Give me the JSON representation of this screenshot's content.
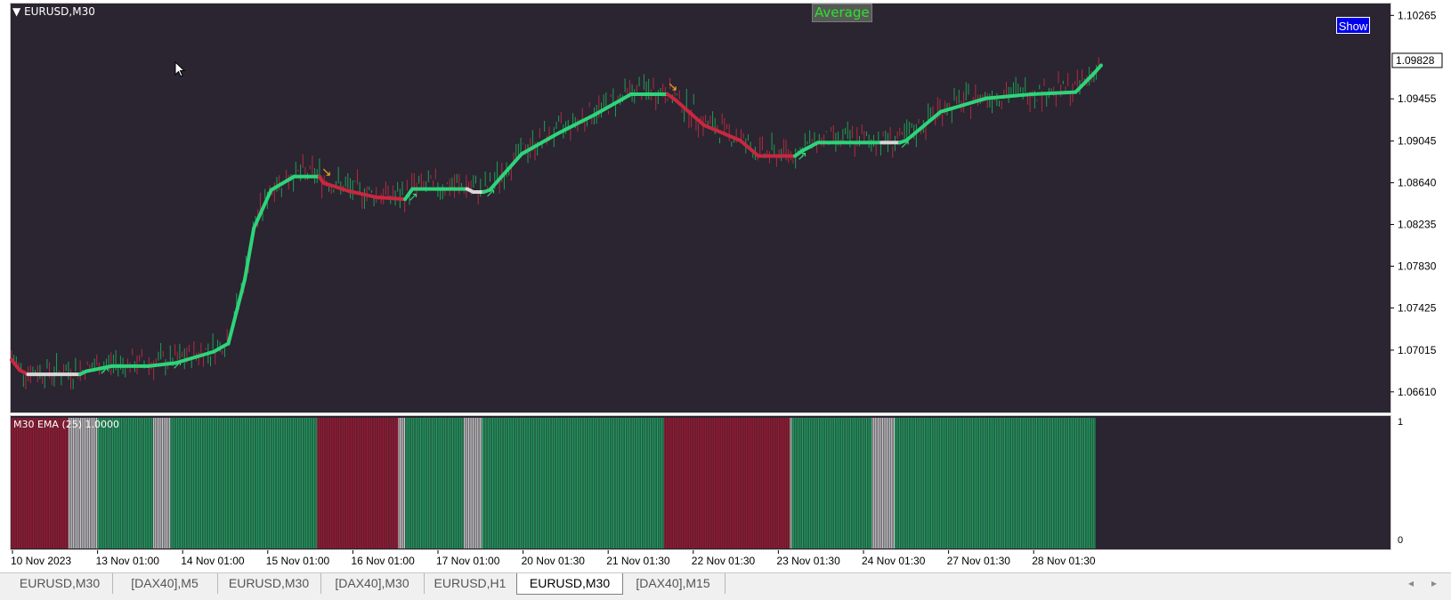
{
  "chart": {
    "symbol_label": "EURUSD,M30",
    "average_label": "Average",
    "show_label": "Show",
    "current_price": "1.09828",
    "price_ticks": [
      "1.10265",
      "1.09455",
      "1.09045",
      "1.08640",
      "1.08235",
      "1.07830",
      "1.07425",
      "1.07015",
      "1.06610"
    ],
    "time_ticks": [
      "10 Nov 2023",
      "13 Nov 01:00",
      "14 Nov 01:00",
      "15 Nov 01:00",
      "16 Nov 01:00",
      "17 Nov 01:00",
      "20 Nov 01:30",
      "21 Nov 01:30",
      "22 Nov 01:30",
      "23 Nov 01:30",
      "24 Nov 01:30",
      "27 Nov 01:30",
      "28 Nov 01:30"
    ]
  },
  "indicator": {
    "label": "M30 EMA (25) 1.0000",
    "scale_top": "1",
    "scale_bottom": "0"
  },
  "tabs": [
    {
      "label": "EURUSD,M30",
      "active": false
    },
    {
      "label": "[DAX40],M5",
      "active": false
    },
    {
      "label": "EURUSD,M30",
      "active": false
    },
    {
      "label": "[DAX40],M30",
      "active": false
    },
    {
      "label": "EURUSD,H1",
      "active": false
    },
    {
      "label": "EURUSD,M30",
      "active": true
    },
    {
      "label": "[DAX40],M15",
      "active": false
    }
  ],
  "colors": {
    "up": "#2ed47a",
    "down": "#c8283f",
    "neutral": "#d8d8d8",
    "bar_up": "#20a060",
    "bar_down": "#a01832",
    "bar_neutral": "#c8c8c8"
  },
  "chart_data": {
    "type": "line",
    "ylim": [
      1.0641,
      1.1038
    ],
    "trend_line": [
      {
        "t": 0,
        "p": 1.0692,
        "s": "down"
      },
      {
        "t": 9,
        "p": 1.0682,
        "s": "down"
      },
      {
        "t": 18,
        "p": 1.0678,
        "s": "down"
      },
      {
        "t": 48,
        "p": 1.0678,
        "s": "neutral"
      },
      {
        "t": 75,
        "p": 1.0678,
        "s": "neutral"
      },
      {
        "t": 82,
        "p": 1.0681,
        "s": "up"
      },
      {
        "t": 110,
        "p": 1.0686,
        "s": "up"
      },
      {
        "t": 150,
        "p": 1.0686,
        "s": "up"
      },
      {
        "t": 180,
        "p": 1.0689,
        "s": "up"
      },
      {
        "t": 222,
        "p": 1.07,
        "s": "up"
      },
      {
        "t": 238,
        "p": 1.0708,
        "s": "up"
      },
      {
        "t": 256,
        "p": 1.077,
        "s": "up"
      },
      {
        "t": 266,
        "p": 1.082,
        "s": "up"
      },
      {
        "t": 285,
        "p": 1.0857,
        "s": "up"
      },
      {
        "t": 310,
        "p": 1.087,
        "s": "up"
      },
      {
        "t": 338,
        "p": 1.087,
        "s": "up"
      },
      {
        "t": 342,
        "p": 1.0864,
        "s": "down"
      },
      {
        "t": 370,
        "p": 1.0856,
        "s": "down"
      },
      {
        "t": 400,
        "p": 1.085,
        "s": "down"
      },
      {
        "t": 432,
        "p": 1.0848,
        "s": "down"
      },
      {
        "t": 440,
        "p": 1.0858,
        "s": "up"
      },
      {
        "t": 470,
        "p": 1.0858,
        "s": "up"
      },
      {
        "t": 500,
        "p": 1.0858,
        "s": "up"
      },
      {
        "t": 507,
        "p": 1.0855,
        "s": "neutral"
      },
      {
        "t": 518,
        "p": 1.0855,
        "s": "neutral"
      },
      {
        "t": 525,
        "p": 1.0857,
        "s": "up"
      },
      {
        "t": 560,
        "p": 1.0892,
        "s": "up"
      },
      {
        "t": 600,
        "p": 1.0912,
        "s": "up"
      },
      {
        "t": 640,
        "p": 1.093,
        "s": "up"
      },
      {
        "t": 680,
        "p": 1.095,
        "s": "up"
      },
      {
        "t": 720,
        "p": 1.095,
        "s": "up"
      },
      {
        "t": 728,
        "p": 1.0945,
        "s": "down"
      },
      {
        "t": 760,
        "p": 1.092,
        "s": "down"
      },
      {
        "t": 800,
        "p": 1.0905,
        "s": "down"
      },
      {
        "t": 820,
        "p": 1.089,
        "s": "down"
      },
      {
        "t": 860,
        "p": 1.089,
        "s": "down"
      },
      {
        "t": 868,
        "p": 1.0895,
        "s": "up"
      },
      {
        "t": 885,
        "p": 1.0903,
        "s": "up"
      },
      {
        "t": 955,
        "p": 1.0903,
        "s": "up"
      },
      {
        "t": 958,
        "p": 1.0903,
        "s": "neutral"
      },
      {
        "t": 975,
        "p": 1.0903,
        "s": "neutral"
      },
      {
        "t": 982,
        "p": 1.0905,
        "s": "up"
      },
      {
        "t": 1020,
        "p": 1.0933,
        "s": "up"
      },
      {
        "t": 1070,
        "p": 1.0946,
        "s": "up"
      },
      {
        "t": 1120,
        "p": 1.095,
        "s": "up"
      },
      {
        "t": 1168,
        "p": 1.0952,
        "s": "up"
      },
      {
        "t": 1188,
        "p": 1.097,
        "s": "up"
      },
      {
        "t": 1196,
        "p": 1.0978,
        "s": "up"
      }
    ],
    "indicator_segments": [
      {
        "from": 0,
        "to": 63,
        "s": "down"
      },
      {
        "from": 63,
        "to": 95,
        "s": "neutral"
      },
      {
        "from": 95,
        "to": 156,
        "s": "up"
      },
      {
        "from": 156,
        "to": 175,
        "s": "neutral"
      },
      {
        "from": 175,
        "to": 336,
        "s": "up"
      },
      {
        "from": 336,
        "to": 425,
        "s": "down"
      },
      {
        "from": 425,
        "to": 433,
        "s": "neutral"
      },
      {
        "from": 433,
        "to": 497,
        "s": "up"
      },
      {
        "from": 497,
        "to": 517,
        "s": "neutral"
      },
      {
        "from": 517,
        "to": 717,
        "s": "up"
      },
      {
        "from": 717,
        "to": 855,
        "s": "down"
      },
      {
        "from": 855,
        "to": 857,
        "s": "neutral"
      },
      {
        "from": 857,
        "to": 945,
        "s": "up"
      },
      {
        "from": 945,
        "to": 970,
        "s": "neutral"
      },
      {
        "from": 970,
        "to": 1190,
        "s": "up"
      }
    ]
  }
}
